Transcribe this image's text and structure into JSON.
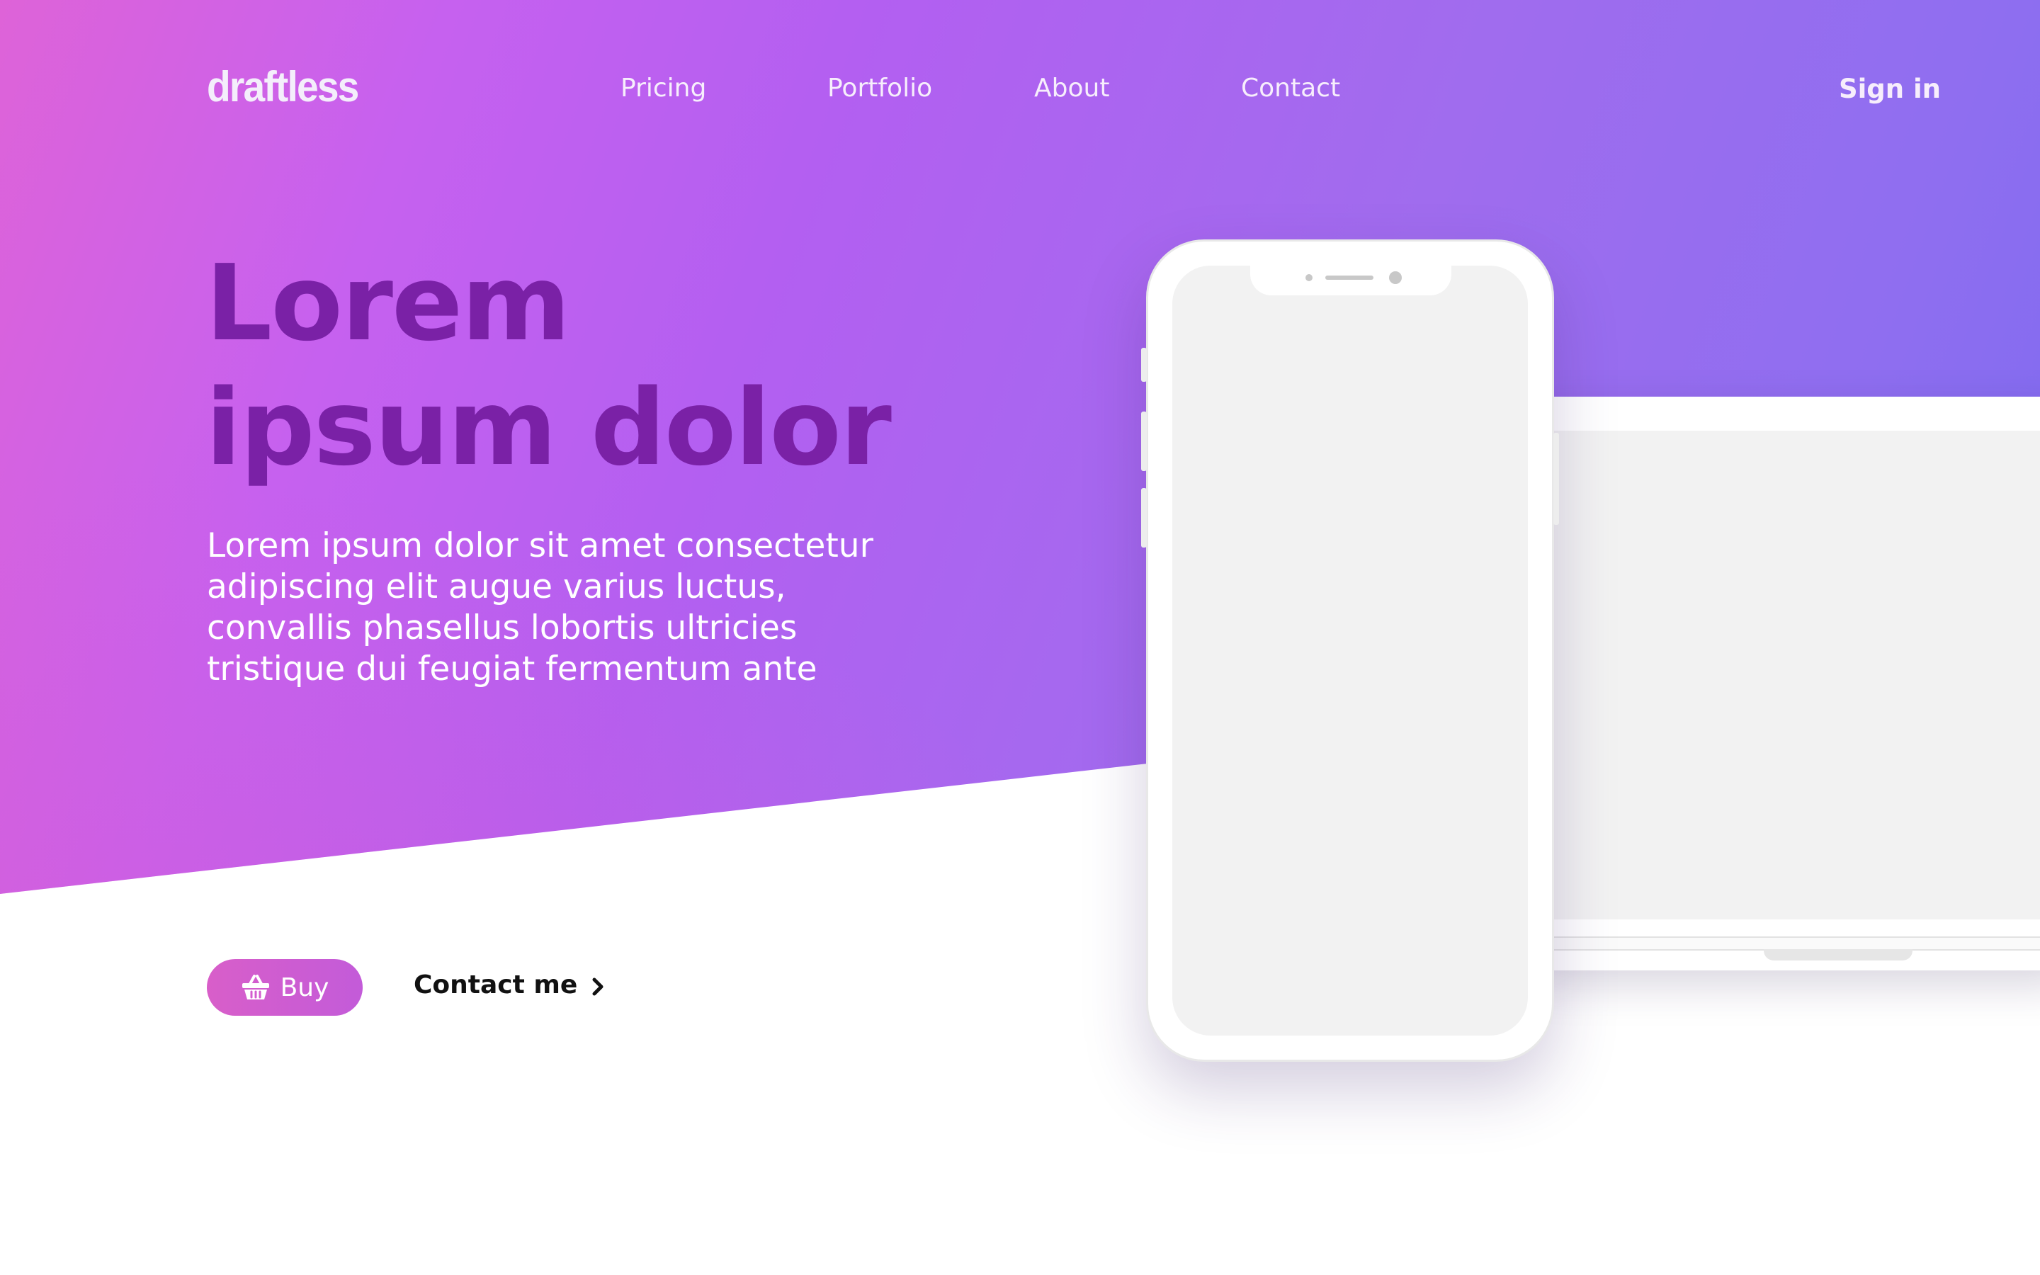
{
  "brand": {
    "logo_text": "draftless"
  },
  "nav": {
    "links": [
      {
        "label": "Pricing"
      },
      {
        "label": "Portfolio"
      },
      {
        "label": "About"
      },
      {
        "label": "Contact"
      }
    ],
    "sign_in_label": "Sign in"
  },
  "hero": {
    "headline_lines": [
      "Lorem",
      "ipsum dolor"
    ],
    "lede": "Lorem ipsum dolor sit amet consectetur adipiscing elit augue varius luctus, convallis phasellus lobortis ultricies tristique dui feugiat fermentum ante",
    "buy_label": "Buy",
    "buy_icon": "basket-icon",
    "contact_label": "Contact me",
    "contact_icon": "chevron-right-icon"
  },
  "colors": {
    "gradient_start": "#de63d8",
    "gradient_end": "#7569f0",
    "headline": "#7a21a6",
    "buy_button": "#d85ec9",
    "device_screen": "#f2f2f2"
  }
}
